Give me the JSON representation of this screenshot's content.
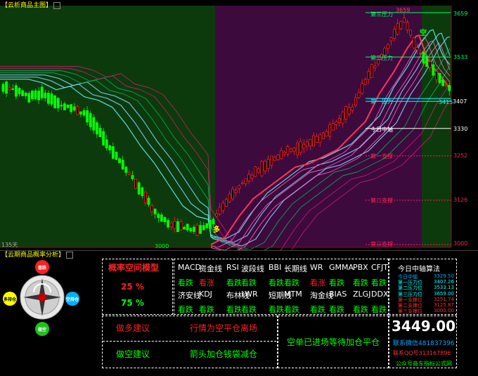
{
  "main_chart": {
    "title": "【云析商品主图】",
    "period_label": "135天",
    "low_label": "3000",
    "high_label": "3659",
    "markers": [
      "多",
      "空"
    ],
    "levels": [
      {
        "name": "第三压力",
        "value": "3659",
        "color": "#00ff66"
      },
      {
        "name": "第二压力",
        "value": "3533",
        "color": "#00ff66"
      },
      {
        "name": "第一压力",
        "value": "3415",
        "color": "#00ffff"
      },
      {
        "name": "今日中轴",
        "value": "3330",
        "color": "#ffffff"
      },
      {
        "name": "第一支撑",
        "value": "3252",
        "color": "#ff2050"
      },
      {
        "name": "第二支撑",
        "value": "3126",
        "color": "#ff2050"
      },
      {
        "name": "第三支撑",
        "value": "3000",
        "color": "#ff2050"
      }
    ],
    "axis_label": "3407",
    "price_tag": "3415"
  },
  "sub_panel": {
    "title": "【云期商品概率分析】",
    "compass": {
      "top": "看跌",
      "left": "多持仓",
      "right": "空持仓",
      "bottom": "做空"
    },
    "prob_title": "概率空间模型",
    "prob_up": "25 %",
    "prob_down": "75 %",
    "indicators_row1": [
      "MACD",
      "资金线",
      "RSI",
      "波段线",
      "BBI",
      "长期线",
      "WR",
      "GMMA",
      "PBX",
      "CFJT"
    ],
    "signals_row1": [
      "看跌",
      "看涨",
      "看跌",
      "看跌",
      "看跌",
      "看跌",
      "看涨",
      "看跌",
      "看跌",
      "看跌"
    ],
    "indicators_row2": [
      "济安线",
      "KDJ",
      "布林线",
      "LWR",
      "短期线",
      "MTM",
      "淘金线",
      "BIAS",
      "ZLGJ",
      "DDX"
    ],
    "signals_row2": [
      "看跌",
      "看跌",
      "看跌",
      "看跌",
      "看跌",
      "看跌",
      "看跌",
      "看跌",
      "看跌",
      "看跌"
    ],
    "advice_long_label": "做多建议",
    "advice_long_text": "行情为空平仓离场",
    "advice_short_label": "做空建议",
    "advice_short_text": "箭头加仓钱袋减仓",
    "position_text": "空单已进场等待加仓平仓",
    "pivot_title": "今日中轴算法",
    "pivot_rows": [
      {
        "name": "今日中轴",
        "value": "3329.50",
        "color": "#00aaff"
      },
      {
        "name": "第一压力位",
        "value": "3407.26",
        "color": "#00ffff"
      },
      {
        "name": "第二压力位",
        "value": "3533.13",
        "color": "#00ffff"
      },
      {
        "name": "第三压力位",
        "value": "3659.00",
        "color": "#00ffff"
      },
      {
        "name": "第一支撑位",
        "value": "3251.74",
        "color": "#ff3030"
      },
      {
        "name": "第二支撑位",
        "value": "3125.87",
        "color": "#ff3030"
      },
      {
        "name": "第三支撑位",
        "value": "3000.00",
        "color": "#ff3030"
      }
    ],
    "price_big": "3449.00",
    "contact1": "联系微信481837396",
    "contact2": "联系QQ号313167896",
    "footer": "公众号商东指标公式网"
  }
}
